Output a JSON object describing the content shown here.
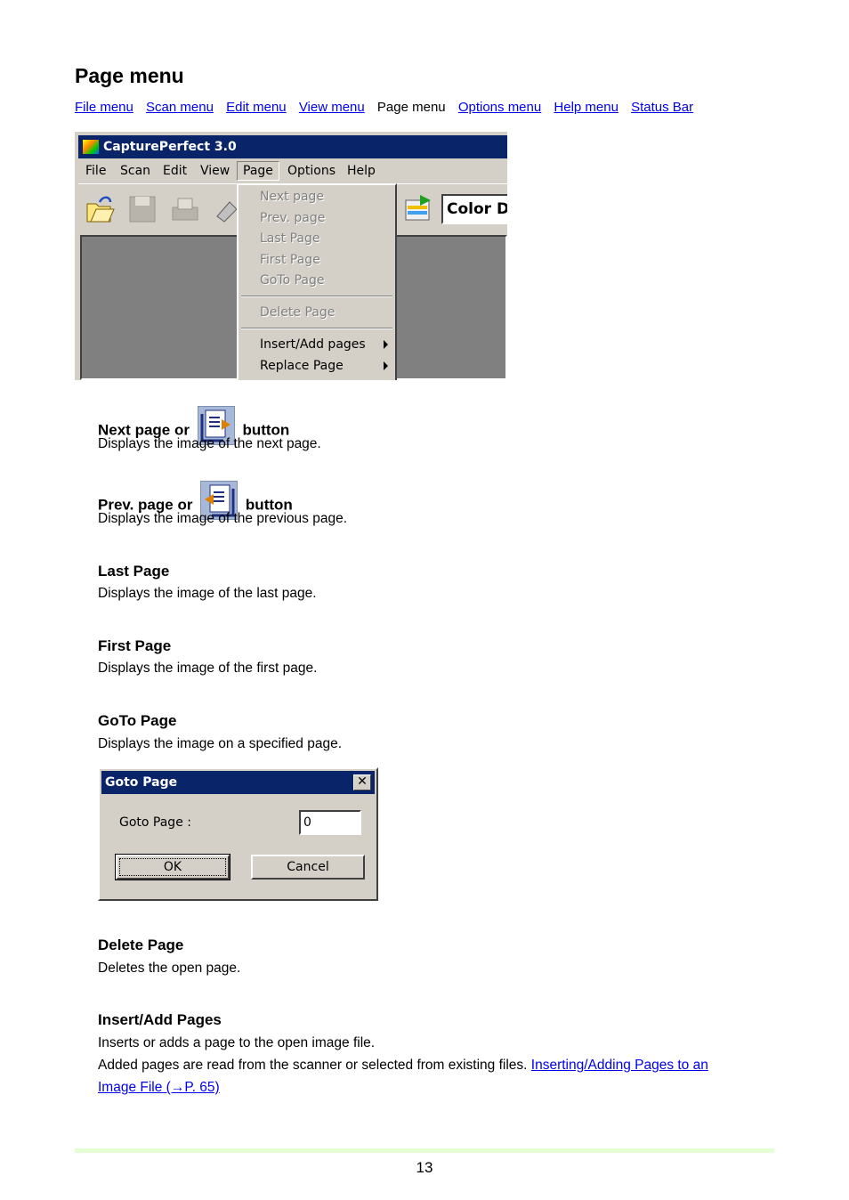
{
  "page": {
    "title": "Page menu",
    "nav": [
      {
        "label": "File menu",
        "link": true
      },
      {
        "label": "Scan menu",
        "link": true
      },
      {
        "label": "Edit menu",
        "link": true
      },
      {
        "label": "View menu",
        "link": true
      },
      {
        "label": "Page menu",
        "link": false
      },
      {
        "label": "Options menu",
        "link": true
      },
      {
        "label": "Help menu",
        "link": true
      },
      {
        "label": "Status Bar",
        "link": true
      }
    ],
    "page_number": "13"
  },
  "app_screenshot": {
    "window_title": "CapturePerfect 3.0",
    "menubar": [
      "File",
      "Scan",
      "Edit",
      "View",
      "Page",
      "Options",
      "Help"
    ],
    "combo_value": "Color D",
    "page_menu_items": [
      "Next page",
      "Prev. page",
      "Last Page",
      "First Page",
      "GoTo Page",
      "Delete Page",
      "Insert/Add pages",
      "Replace Page"
    ]
  },
  "sections": {
    "next": {
      "title_pre": "Next page or",
      "title_post": "button",
      "desc": "Displays the image of the next page."
    },
    "prev": {
      "title_pre": "Prev. page or",
      "title_post": "button",
      "desc": "Displays the image of the previous page."
    },
    "last": {
      "title": "Last Page",
      "desc": "Displays the image of the last page."
    },
    "first": {
      "title": "First Page",
      "desc": "Displays the image of the first page."
    },
    "goto": {
      "title": "GoTo Page",
      "desc": "Displays the image on a specified page."
    },
    "delete": {
      "title": "Delete Page",
      "desc": "Deletes the open page."
    },
    "insert": {
      "title": "Insert/Add Pages",
      "desc1": "Inserts or adds a page to the open image file.",
      "desc2": "Added pages are read from the scanner or selected from existing files.",
      "link1": "Inserting/Adding Pages to an",
      "link2": "Image File (→P. 65)"
    }
  },
  "goto_dialog": {
    "title": "Goto Page",
    "label": "Goto Page :",
    "value": "0",
    "ok": "OK",
    "cancel": "Cancel"
  }
}
